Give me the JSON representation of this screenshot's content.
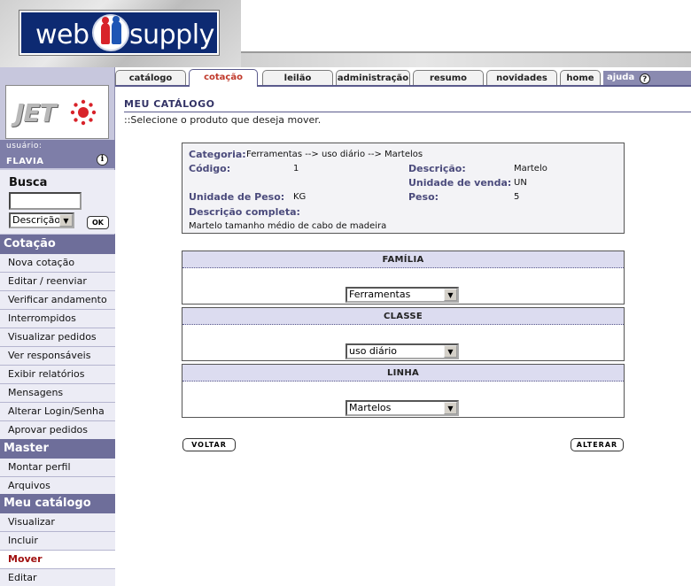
{
  "header": {
    "logo_web": "web",
    "logo_supply": "supply"
  },
  "tabs": [
    {
      "label": "catálogo"
    },
    {
      "label": "cotação"
    },
    {
      "label": "leilão"
    },
    {
      "label": "administração"
    },
    {
      "label": "resumo"
    },
    {
      "label": "novidades"
    },
    {
      "label": "home"
    }
  ],
  "help": {
    "label": "ajuda",
    "icon": "question-icon",
    "icon_glyph": "?"
  },
  "sidebar": {
    "client_logo_text": "JET",
    "user_label": "usuário:",
    "user_name": "FLAVIA",
    "info_glyph": "i",
    "search": {
      "title": "Busca",
      "value": "",
      "select_value": "Descrição",
      "ok_label": "OK"
    },
    "sections": [
      {
        "title": "Cotação",
        "items": [
          "Nova cotação",
          "Editar / reenviar",
          "Verificar andamento",
          "Interrompidos",
          "Visualizar pedidos",
          "Ver responsáveis",
          "Exibir relatórios",
          "Mensagens",
          "Alterar Login/Senha",
          "Aprovar pedidos"
        ]
      },
      {
        "title": "Master",
        "items": [
          "Montar perfil",
          "Arquivos"
        ]
      },
      {
        "title": "Meu catálogo",
        "items": [
          "Visualizar",
          "Incluir",
          "Mover",
          "Editar"
        ]
      }
    ]
  },
  "main": {
    "title": "MEU CATÁLOGO",
    "subtitle": "::Selecione o produto que deseja mover.",
    "product": {
      "categoria_label": "Categoria:",
      "categoria_value": "Ferramentas --> uso diário --> Martelos",
      "codigo_label": "Código:",
      "codigo_value": "1",
      "descricao_label": "Descrição:",
      "descricao_value": "Martelo",
      "unidade_venda_label": "Unidade de venda:",
      "unidade_venda_value": "UN",
      "unidade_peso_label": "Unidade de Peso:",
      "unidade_peso_value": "KG",
      "peso_label": "Peso:",
      "peso_value": "5",
      "descricao_completa_label": "Descrição completa:",
      "descricao_completa_value": "Martelo tamanho médio de cabo de madeira"
    },
    "familia": {
      "title": "FAMÍLIA",
      "value": "Ferramentas"
    },
    "classe": {
      "title": "CLASSE",
      "value": "uso diário"
    },
    "linha": {
      "title": "LINHA",
      "value": "Martelos"
    },
    "voltar_label": "VOLTAR",
    "alterar_label": "ALTERAR"
  },
  "colors": {
    "sidebar_bg": "#c7c7dd",
    "section_head": "#6e6e9a",
    "active_tab_text": "#c0392b",
    "current_item_text": "#a01010",
    "label_text": "#4b4b7c"
  }
}
